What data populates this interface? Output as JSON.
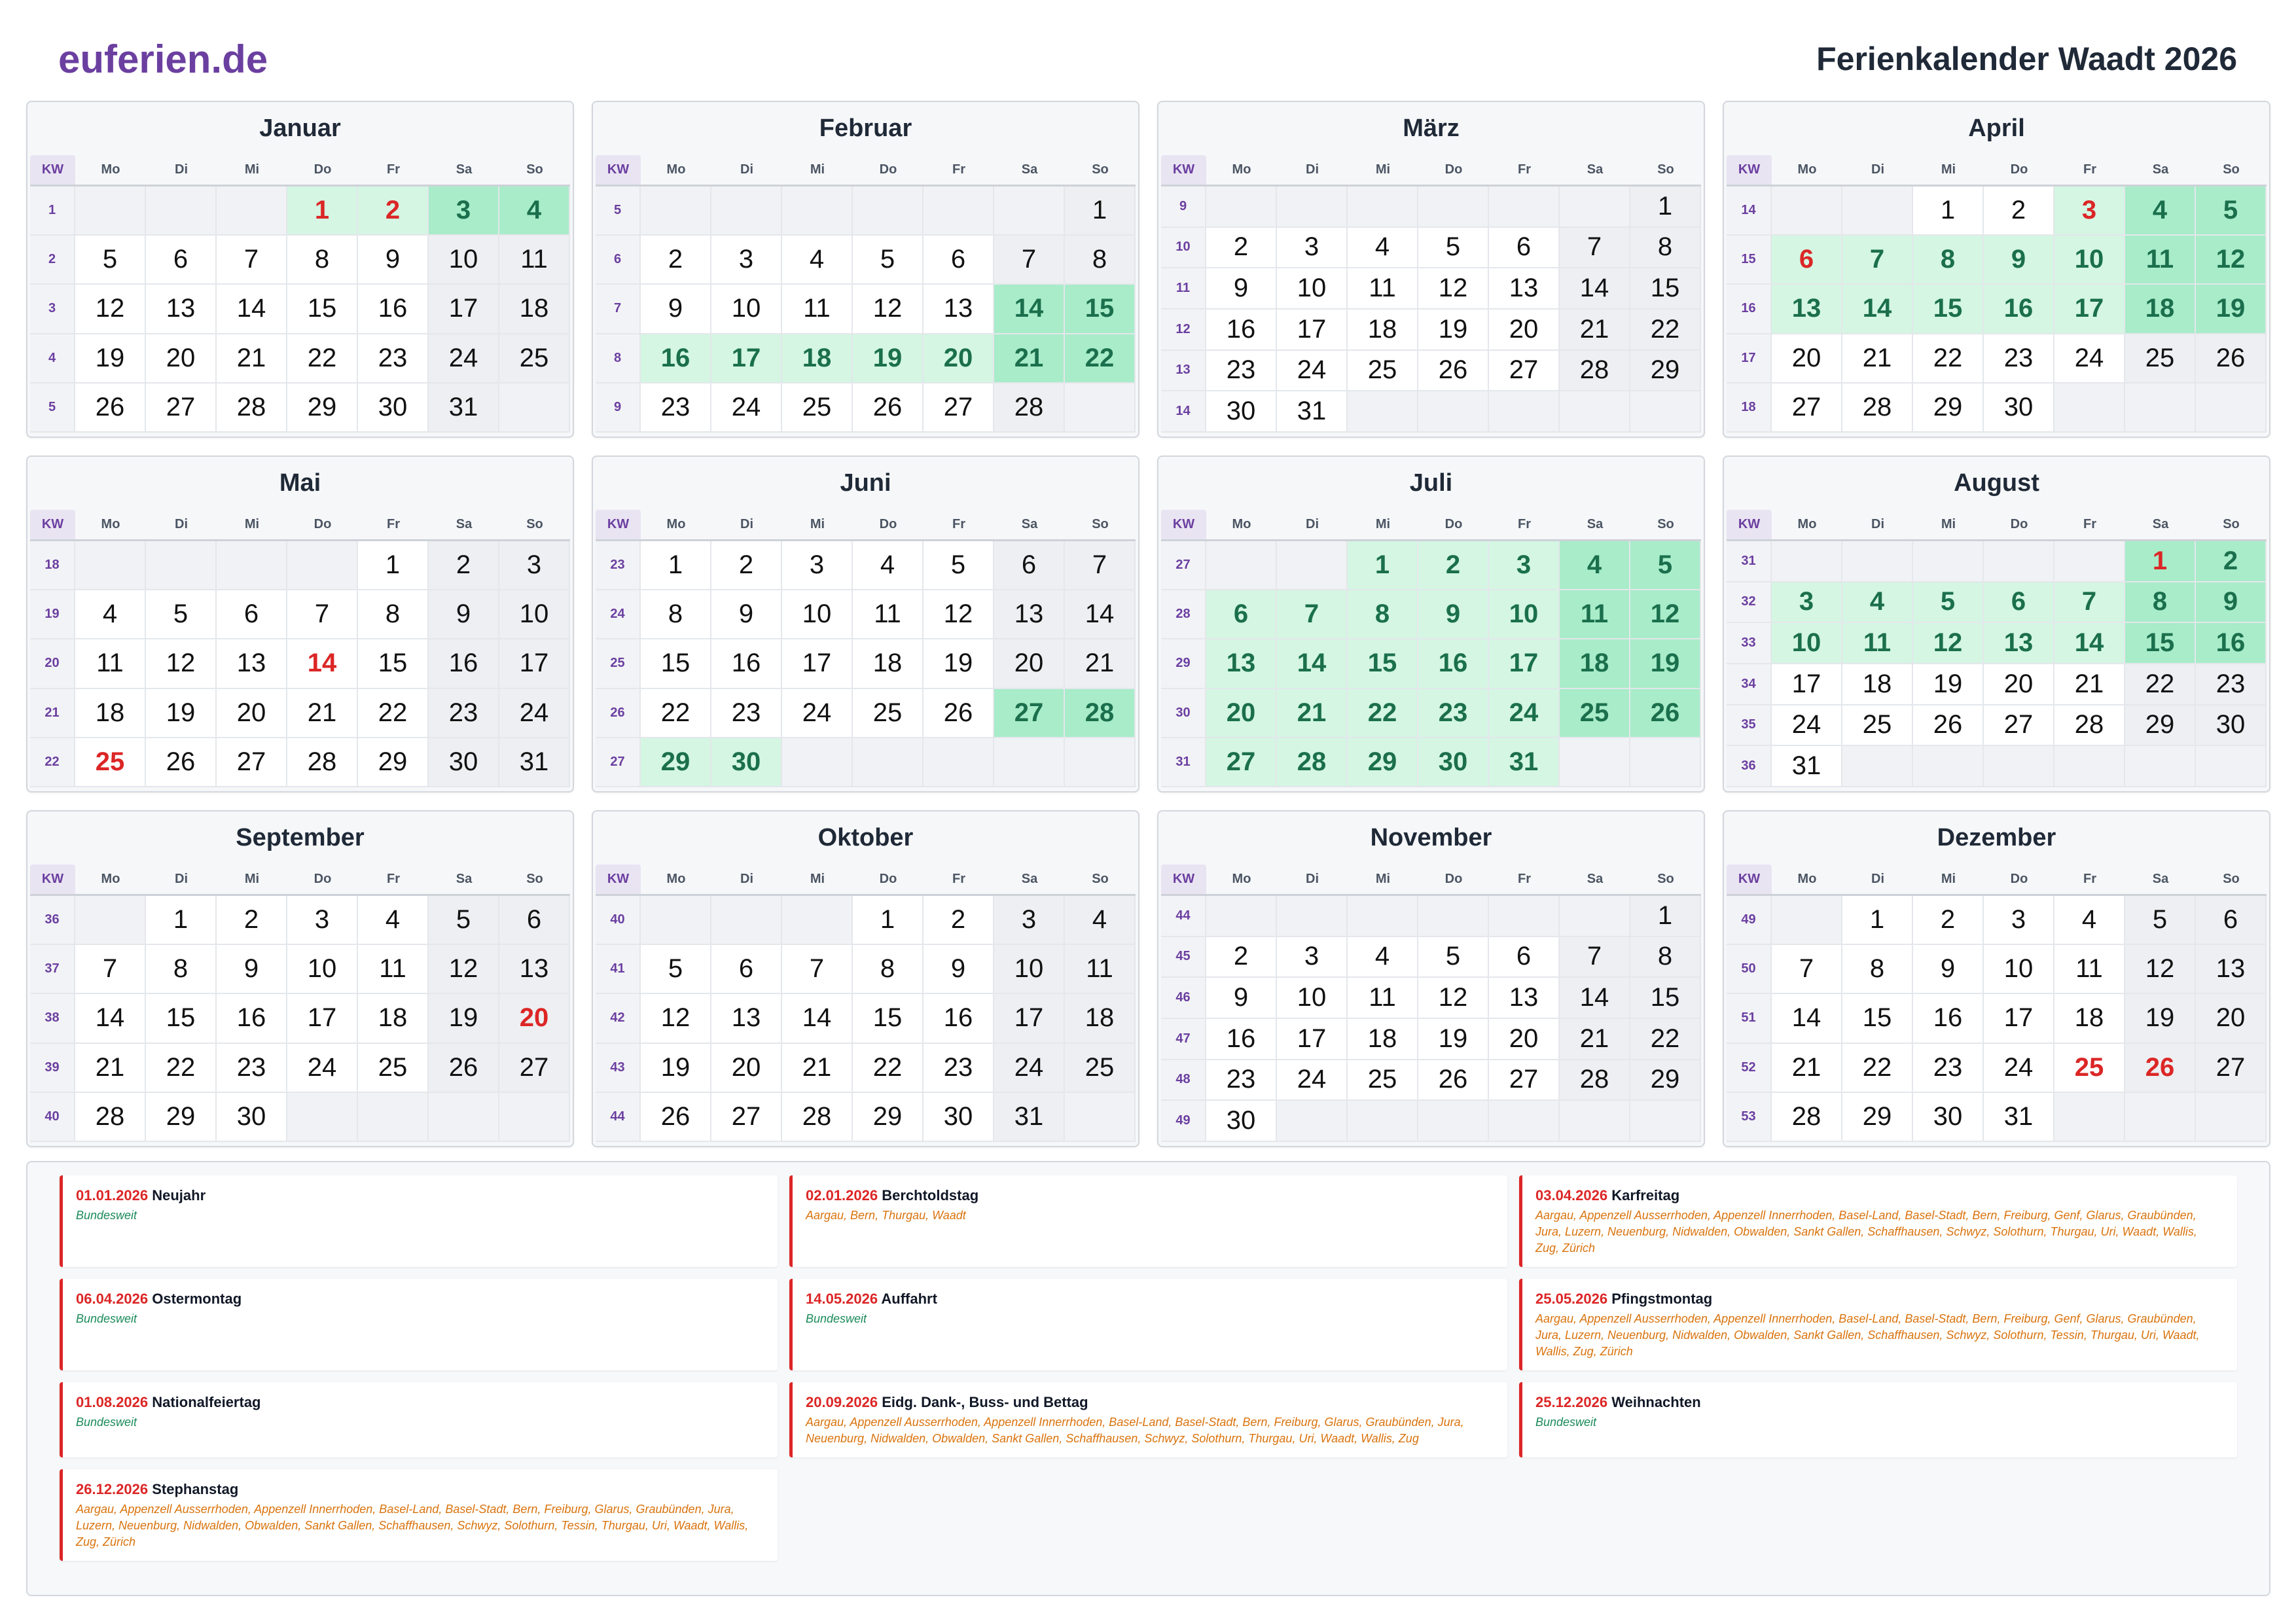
{
  "header": {
    "logo": "euferien.de",
    "title": "Ferienkalender Waadt 2026"
  },
  "weekday_header": {
    "kw": "KW",
    "days": [
      "Mo",
      "Di",
      "Mi",
      "Do",
      "Fr",
      "Sa",
      "So"
    ]
  },
  "colors": {
    "brand": "#6b3fa0",
    "title": "#1f2937",
    "holiday": "#dc2626",
    "vacation_text": "#1b6f4c",
    "vacation_bg": "#d4f6e3",
    "vacation_weekend_bg": "#a8ecc9",
    "weekend_bg": "#edeff2",
    "national_scope": "#1a8a5a",
    "regional_scope": "#d9730d"
  },
  "months": [
    {
      "name": "Januar",
      "vacation_days": [
        1,
        2,
        3,
        4
      ],
      "holiday_days": [
        1,
        2
      ],
      "weeks": [
        {
          "kw": 1,
          "days": [
            null,
            null,
            null,
            1,
            2,
            3,
            4
          ]
        },
        {
          "kw": 2,
          "days": [
            5,
            6,
            7,
            8,
            9,
            10,
            11
          ]
        },
        {
          "kw": 3,
          "days": [
            12,
            13,
            14,
            15,
            16,
            17,
            18
          ]
        },
        {
          "kw": 4,
          "days": [
            19,
            20,
            21,
            22,
            23,
            24,
            25
          ]
        },
        {
          "kw": 5,
          "days": [
            26,
            27,
            28,
            29,
            30,
            31,
            null
          ]
        }
      ]
    },
    {
      "name": "Februar",
      "vacation_days": [
        14,
        15,
        16,
        17,
        18,
        19,
        20,
        21,
        22
      ],
      "holiday_days": [],
      "weeks": [
        {
          "kw": 5,
          "days": [
            null,
            null,
            null,
            null,
            null,
            null,
            1
          ]
        },
        {
          "kw": 6,
          "days": [
            2,
            3,
            4,
            5,
            6,
            7,
            8
          ]
        },
        {
          "kw": 7,
          "days": [
            9,
            10,
            11,
            12,
            13,
            14,
            15
          ]
        },
        {
          "kw": 8,
          "days": [
            16,
            17,
            18,
            19,
            20,
            21,
            22
          ]
        },
        {
          "kw": 9,
          "days": [
            23,
            24,
            25,
            26,
            27,
            28,
            null
          ]
        }
      ]
    },
    {
      "name": "März",
      "vacation_days": [],
      "holiday_days": [],
      "weeks": [
        {
          "kw": 9,
          "days": [
            null,
            null,
            null,
            null,
            null,
            null,
            1
          ]
        },
        {
          "kw": 10,
          "days": [
            2,
            3,
            4,
            5,
            6,
            7,
            8
          ]
        },
        {
          "kw": 11,
          "days": [
            9,
            10,
            11,
            12,
            13,
            14,
            15
          ]
        },
        {
          "kw": 12,
          "days": [
            16,
            17,
            18,
            19,
            20,
            21,
            22
          ]
        },
        {
          "kw": 13,
          "days": [
            23,
            24,
            25,
            26,
            27,
            28,
            29
          ]
        },
        {
          "kw": 14,
          "days": [
            30,
            31,
            null,
            null,
            null,
            null,
            null
          ]
        }
      ]
    },
    {
      "name": "April",
      "vacation_days": [
        3,
        4,
        5,
        6,
        7,
        8,
        9,
        10,
        11,
        12,
        13,
        14,
        15,
        16,
        17,
        18,
        19
      ],
      "holiday_days": [
        3,
        6
      ],
      "weeks": [
        {
          "kw": 14,
          "days": [
            null,
            null,
            1,
            2,
            3,
            4,
            5
          ]
        },
        {
          "kw": 15,
          "days": [
            6,
            7,
            8,
            9,
            10,
            11,
            12
          ]
        },
        {
          "kw": 16,
          "days": [
            13,
            14,
            15,
            16,
            17,
            18,
            19
          ]
        },
        {
          "kw": 17,
          "days": [
            20,
            21,
            22,
            23,
            24,
            25,
            26
          ]
        },
        {
          "kw": 18,
          "days": [
            27,
            28,
            29,
            30,
            null,
            null,
            null
          ]
        }
      ]
    },
    {
      "name": "Mai",
      "vacation_days": [],
      "holiday_days": [
        14,
        25
      ],
      "weeks": [
        {
          "kw": 18,
          "days": [
            null,
            null,
            null,
            null,
            1,
            2,
            3
          ]
        },
        {
          "kw": 19,
          "days": [
            4,
            5,
            6,
            7,
            8,
            9,
            10
          ]
        },
        {
          "kw": 20,
          "days": [
            11,
            12,
            13,
            14,
            15,
            16,
            17
          ]
        },
        {
          "kw": 21,
          "days": [
            18,
            19,
            20,
            21,
            22,
            23,
            24
          ]
        },
        {
          "kw": 22,
          "days": [
            25,
            26,
            27,
            28,
            29,
            30,
            31
          ]
        }
      ]
    },
    {
      "name": "Juni",
      "vacation_days": [
        27,
        28,
        29,
        30
      ],
      "holiday_days": [],
      "weeks": [
        {
          "kw": 23,
          "days": [
            1,
            2,
            3,
            4,
            5,
            6,
            7
          ]
        },
        {
          "kw": 24,
          "days": [
            8,
            9,
            10,
            11,
            12,
            13,
            14
          ]
        },
        {
          "kw": 25,
          "days": [
            15,
            16,
            17,
            18,
            19,
            20,
            21
          ]
        },
        {
          "kw": 26,
          "days": [
            22,
            23,
            24,
            25,
            26,
            27,
            28
          ]
        },
        {
          "kw": 27,
          "days": [
            29,
            30,
            null,
            null,
            null,
            null,
            null
          ]
        }
      ]
    },
    {
      "name": "Juli",
      "vacation_days": [
        1,
        2,
        3,
        4,
        5,
        6,
        7,
        8,
        9,
        10,
        11,
        12,
        13,
        14,
        15,
        16,
        17,
        18,
        19,
        20,
        21,
        22,
        23,
        24,
        25,
        26,
        27,
        28,
        29,
        30,
        31
      ],
      "holiday_days": [],
      "weeks": [
        {
          "kw": 27,
          "days": [
            null,
            null,
            1,
            2,
            3,
            4,
            5
          ]
        },
        {
          "kw": 28,
          "days": [
            6,
            7,
            8,
            9,
            10,
            11,
            12
          ]
        },
        {
          "kw": 29,
          "days": [
            13,
            14,
            15,
            16,
            17,
            18,
            19
          ]
        },
        {
          "kw": 30,
          "days": [
            20,
            21,
            22,
            23,
            24,
            25,
            26
          ]
        },
        {
          "kw": 31,
          "days": [
            27,
            28,
            29,
            30,
            31,
            null,
            null
          ]
        }
      ]
    },
    {
      "name": "August",
      "vacation_days": [
        1,
        2,
        3,
        4,
        5,
        6,
        7,
        8,
        9,
        10,
        11,
        12,
        13,
        14,
        15,
        16
      ],
      "holiday_days": [
        1
      ],
      "weeks": [
        {
          "kw": 31,
          "days": [
            null,
            null,
            null,
            null,
            null,
            1,
            2
          ]
        },
        {
          "kw": 32,
          "days": [
            3,
            4,
            5,
            6,
            7,
            8,
            9
          ]
        },
        {
          "kw": 33,
          "days": [
            10,
            11,
            12,
            13,
            14,
            15,
            16
          ]
        },
        {
          "kw": 34,
          "days": [
            17,
            18,
            19,
            20,
            21,
            22,
            23
          ]
        },
        {
          "kw": 35,
          "days": [
            24,
            25,
            26,
            27,
            28,
            29,
            30
          ]
        },
        {
          "kw": 36,
          "days": [
            31,
            null,
            null,
            null,
            null,
            null,
            null
          ]
        }
      ]
    },
    {
      "name": "September",
      "vacation_days": [],
      "holiday_days": [
        20
      ],
      "weeks": [
        {
          "kw": 36,
          "days": [
            null,
            1,
            2,
            3,
            4,
            5,
            6
          ]
        },
        {
          "kw": 37,
          "days": [
            7,
            8,
            9,
            10,
            11,
            12,
            13
          ]
        },
        {
          "kw": 38,
          "days": [
            14,
            15,
            16,
            17,
            18,
            19,
            20
          ]
        },
        {
          "kw": 39,
          "days": [
            21,
            22,
            23,
            24,
            25,
            26,
            27
          ]
        },
        {
          "kw": 40,
          "days": [
            28,
            29,
            30,
            null,
            null,
            null,
            null
          ]
        }
      ]
    },
    {
      "name": "Oktober",
      "vacation_days": [],
      "holiday_days": [],
      "weeks": [
        {
          "kw": 40,
          "days": [
            null,
            null,
            null,
            1,
            2,
            3,
            4
          ]
        },
        {
          "kw": 41,
          "days": [
            5,
            6,
            7,
            8,
            9,
            10,
            11
          ]
        },
        {
          "kw": 42,
          "days": [
            12,
            13,
            14,
            15,
            16,
            17,
            18
          ]
        },
        {
          "kw": 43,
          "days": [
            19,
            20,
            21,
            22,
            23,
            24,
            25
          ]
        },
        {
          "kw": 44,
          "days": [
            26,
            27,
            28,
            29,
            30,
            31,
            null
          ]
        }
      ]
    },
    {
      "name": "November",
      "vacation_days": [],
      "holiday_days": [],
      "weeks": [
        {
          "kw": 44,
          "days": [
            null,
            null,
            null,
            null,
            null,
            null,
            1
          ]
        },
        {
          "kw": 45,
          "days": [
            2,
            3,
            4,
            5,
            6,
            7,
            8
          ]
        },
        {
          "kw": 46,
          "days": [
            9,
            10,
            11,
            12,
            13,
            14,
            15
          ]
        },
        {
          "kw": 47,
          "days": [
            16,
            17,
            18,
            19,
            20,
            21,
            22
          ]
        },
        {
          "kw": 48,
          "days": [
            23,
            24,
            25,
            26,
            27,
            28,
            29
          ]
        },
        {
          "kw": 49,
          "days": [
            30,
            null,
            null,
            null,
            null,
            null,
            null
          ]
        }
      ]
    },
    {
      "name": "Dezember",
      "vacation_days": [],
      "holiday_days": [
        25,
        26
      ],
      "weeks": [
        {
          "kw": 49,
          "days": [
            null,
            1,
            2,
            3,
            4,
            5,
            6
          ]
        },
        {
          "kw": 50,
          "days": [
            7,
            8,
            9,
            10,
            11,
            12,
            13
          ]
        },
        {
          "kw": 51,
          "days": [
            14,
            15,
            16,
            17,
            18,
            19,
            20
          ]
        },
        {
          "kw": 52,
          "days": [
            21,
            22,
            23,
            24,
            25,
            26,
            27
          ]
        },
        {
          "kw": 53,
          "days": [
            28,
            29,
            30,
            31,
            null,
            null,
            null
          ]
        }
      ]
    }
  ],
  "legend": {
    "entries": [
      {
        "date": "01.01.2026",
        "name": "Neujahr",
        "scope": "Bundesweit"
      },
      {
        "date": "02.01.2026",
        "name": "Berchtoldstag",
        "scope": "Aargau, Bern, Thurgau, Waadt"
      },
      {
        "date": "03.04.2026",
        "name": "Karfreitag",
        "scope": "Aargau, Appenzell Ausserrhoden, Appenzell Innerrhoden, Basel-Land, Basel-Stadt, Bern, Freiburg, Genf, Glarus, Graubünden, Jura, Luzern, Neuenburg, Nidwalden, Obwalden, Sankt Gallen, Schaffhausen, Schwyz, Solothurn, Thurgau, Uri, Waadt, Wallis, Zug, Zürich"
      },
      {
        "date": "06.04.2026",
        "name": "Ostermontag",
        "scope": "Bundesweit"
      },
      {
        "date": "14.05.2026",
        "name": "Auffahrt",
        "scope": "Bundesweit"
      },
      {
        "date": "25.05.2026",
        "name": "Pfingstmontag",
        "scope": "Aargau, Appenzell Ausserrhoden, Appenzell Innerrhoden, Basel-Land, Basel-Stadt, Bern, Freiburg, Genf, Glarus, Graubünden, Jura, Luzern, Neuenburg, Nidwalden, Obwalden, Sankt Gallen, Schaffhausen, Schwyz, Solothurn, Tessin, Thurgau, Uri, Waadt, Wallis, Zug, Zürich"
      },
      {
        "date": "01.08.2026",
        "name": "Nationalfeiertag",
        "scope": "Bundesweit"
      },
      {
        "date": "20.09.2026",
        "name": "Eidg. Dank-, Buss- und Bettag",
        "scope": "Aargau, Appenzell Ausserrhoden, Appenzell Innerrhoden, Basel-Land, Basel-Stadt, Bern, Freiburg, Glarus, Graubünden, Jura, Neuenburg, Nidwalden, Obwalden, Sankt Gallen, Schaffhausen, Schwyz, Solothurn, Thurgau, Uri, Waadt, Wallis, Zug"
      },
      {
        "date": "25.12.2026",
        "name": "Weihnachten",
        "scope": "Bundesweit"
      },
      {
        "date": "26.12.2026",
        "name": "Stephanstag",
        "scope": "Aargau, Appenzell Ausserrhoden, Appenzell Innerrhoden, Basel-Land, Basel-Stadt, Bern, Freiburg, Glarus, Graubünden, Jura, Luzern, Neuenburg, Nidwalden, Obwalden, Sankt Gallen, Schaffhausen, Schwyz, Solothurn, Tessin, Thurgau, Uri, Waadt, Wallis, Zug, Zürich"
      }
    ]
  }
}
